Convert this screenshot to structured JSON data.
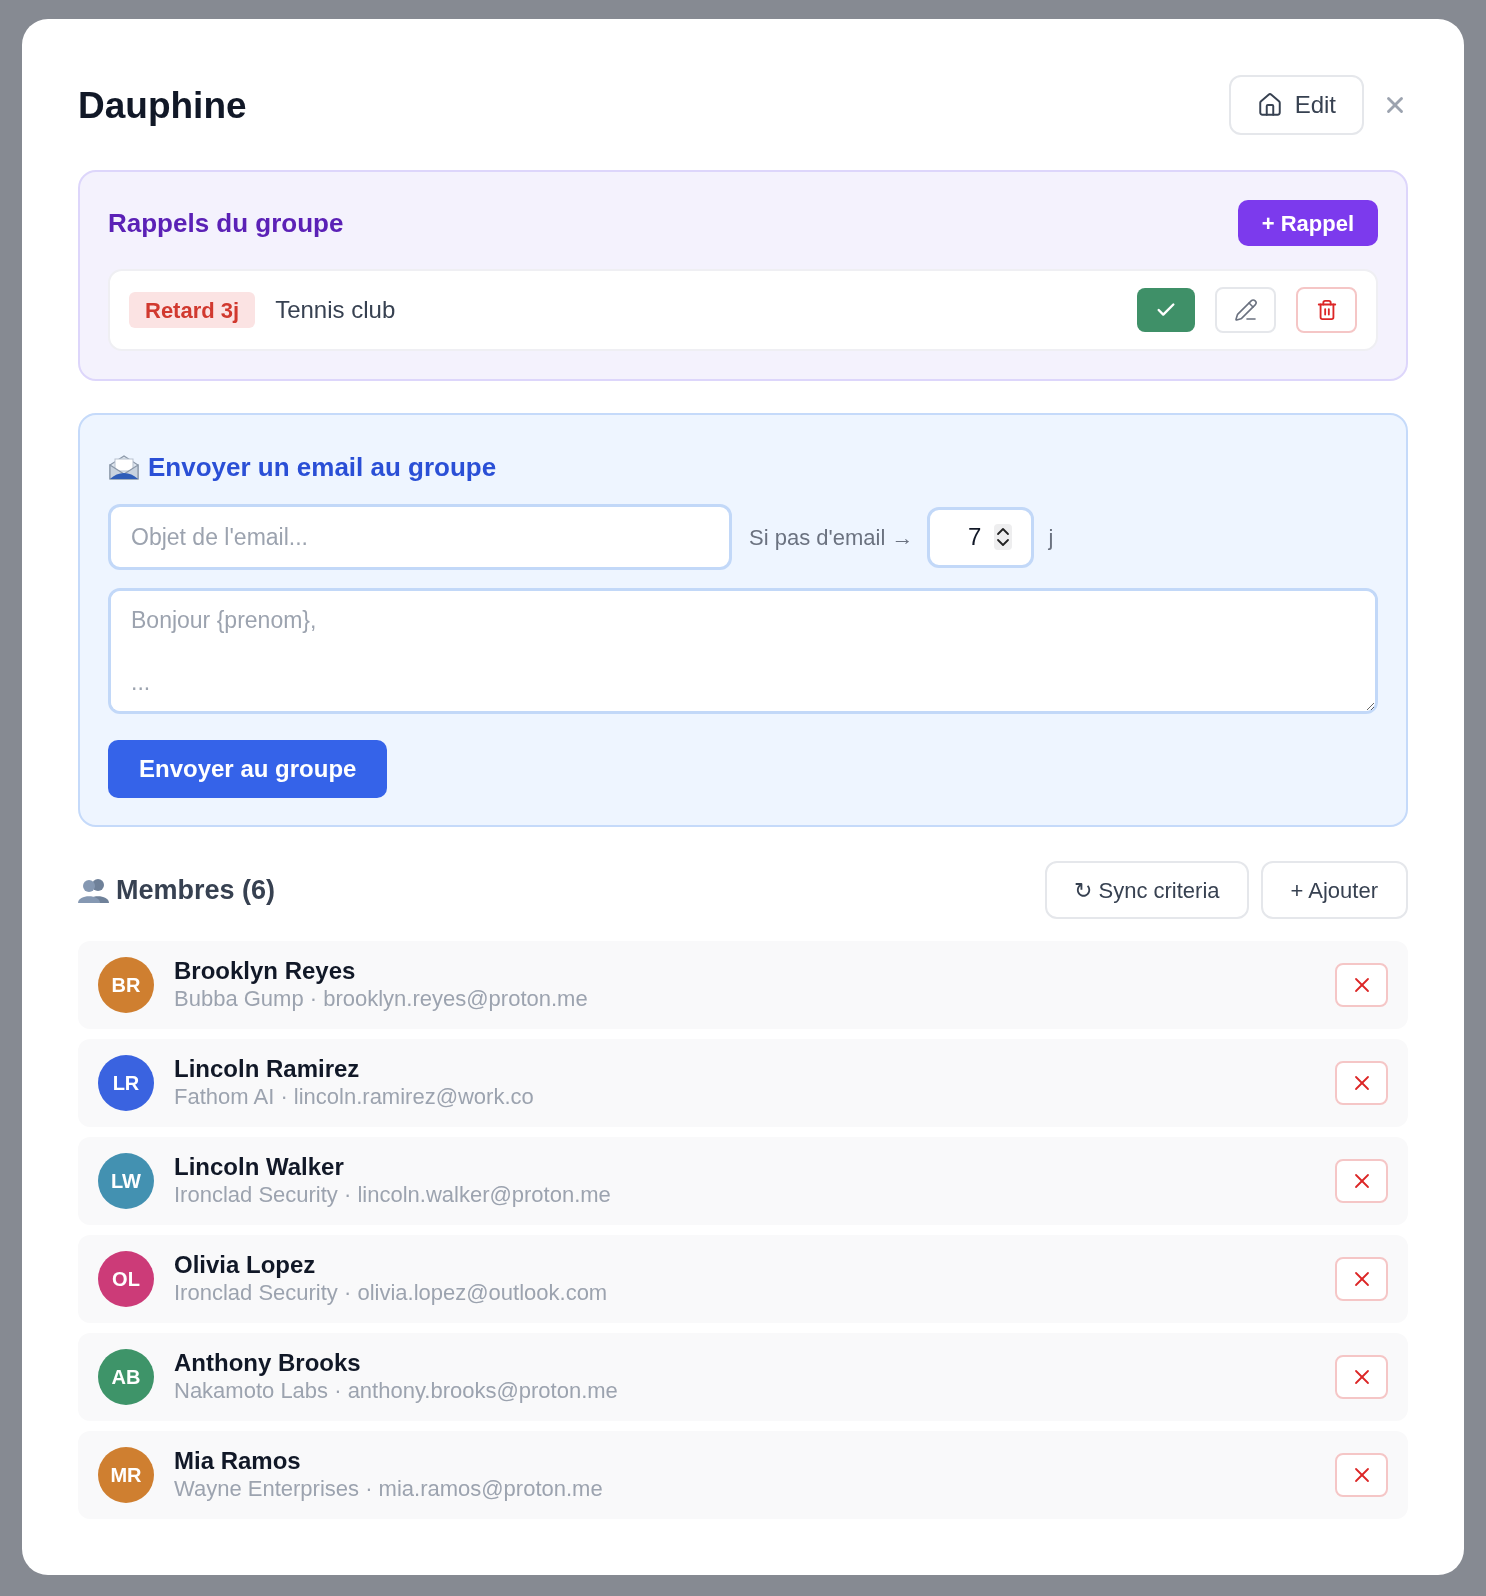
{
  "dialog": {
    "title": "Dauphine",
    "edit_button": "Edit"
  },
  "reminders": {
    "title": "Rappels du groupe",
    "add_button": "+ Rappel",
    "items": [
      {
        "badge": "Retard 3j",
        "label": "Tennis club"
      }
    ]
  },
  "email": {
    "title": "Envoyer un email au groupe",
    "subject": {
      "placeholder": "Objet de l'email..."
    },
    "fallback_label": "Si pas d'email →",
    "fallback_days": {
      "value": "7"
    },
    "days_unit": "j",
    "body": {
      "placeholder": "Bonjour {prenom},\n\n..."
    },
    "send_button": "Envoyer au groupe"
  },
  "members": {
    "title": "Membres (6)",
    "sync_button": "↻ Sync criteria",
    "add_button": "+ Ajouter",
    "items": [
      {
        "initials": "BR",
        "name": "Brooklyn Reyes",
        "subtitle": "Bubba Gump · brooklyn.reyes@proton.me",
        "color": "#cf7f30"
      },
      {
        "initials": "LR",
        "name": "Lincoln Ramirez",
        "subtitle": "Fathom AI · lincoln.ramirez@work.co",
        "color": "#3a63e0"
      },
      {
        "initials": "LW",
        "name": "Lincoln Walker",
        "subtitle": "Ironclad Security · lincoln.walker@proton.me",
        "color": "#4391b1"
      },
      {
        "initials": "OL",
        "name": "Olivia Lopez",
        "subtitle": "Ironclad Security · olivia.lopez@outlook.com",
        "color": "#cc3b78"
      },
      {
        "initials": "AB",
        "name": "Anthony Brooks",
        "subtitle": "Nakamoto Labs · anthony.brooks@proton.me",
        "color": "#3e9469"
      },
      {
        "initials": "MR",
        "name": "Mia Ramos",
        "subtitle": "Wayne Enterprises · mia.ramos@proton.me",
        "color": "#cf7f30"
      }
    ]
  }
}
